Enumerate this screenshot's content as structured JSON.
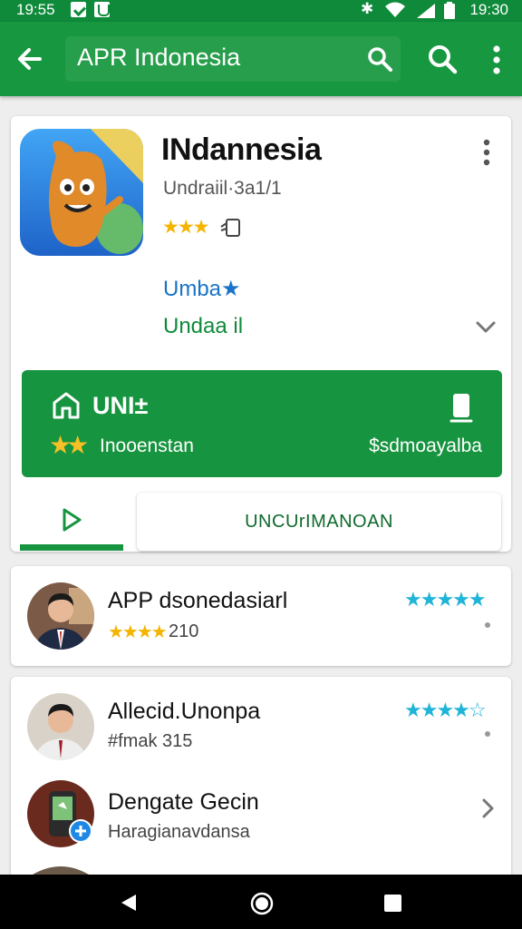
{
  "status_bar": {
    "time_left": "19:55",
    "time_right": "19:30",
    "icons": [
      "download-icon",
      "shield-icon",
      "bluetooth-icon",
      "wifi-icon",
      "signal-icon",
      "battery-icon"
    ]
  },
  "toolbar": {
    "title": "APR Indonesia",
    "icons": [
      "back-arrow-icon",
      "search-icon",
      "search-icon",
      "more-vert-icon"
    ]
  },
  "app": {
    "name": "INdannesia",
    "subtitle": "Undraiil·3a1/1",
    "rating_stars": "★★★",
    "link_blue": "Umba★",
    "link_green": "Undaa il",
    "install": {
      "label": "UNI±",
      "left_text": "Inooenstan",
      "right_text": "$sdmoayalba"
    },
    "tab_right_label": "UNCUrIMANOAN"
  },
  "review": {
    "title": "APP dsonedasiarl",
    "stars": "★★★★",
    "count": "210",
    "right_stars": "★★★★★"
  },
  "list": [
    {
      "title": "Allecid.Unonpa",
      "subtitle": "#fmak 315",
      "right_stars": "★★★★☆"
    },
    {
      "title": "Dengate Gecin",
      "subtitle": "Haragianavdansa"
    }
  ],
  "colors": {
    "status_bar": "#0f8a3a",
    "toolbar": "#17973f",
    "install_button": "#16943f",
    "link_blue": "#1a73c8",
    "star_gold": "#f4b400",
    "star_teal": "#1fb4d8"
  }
}
